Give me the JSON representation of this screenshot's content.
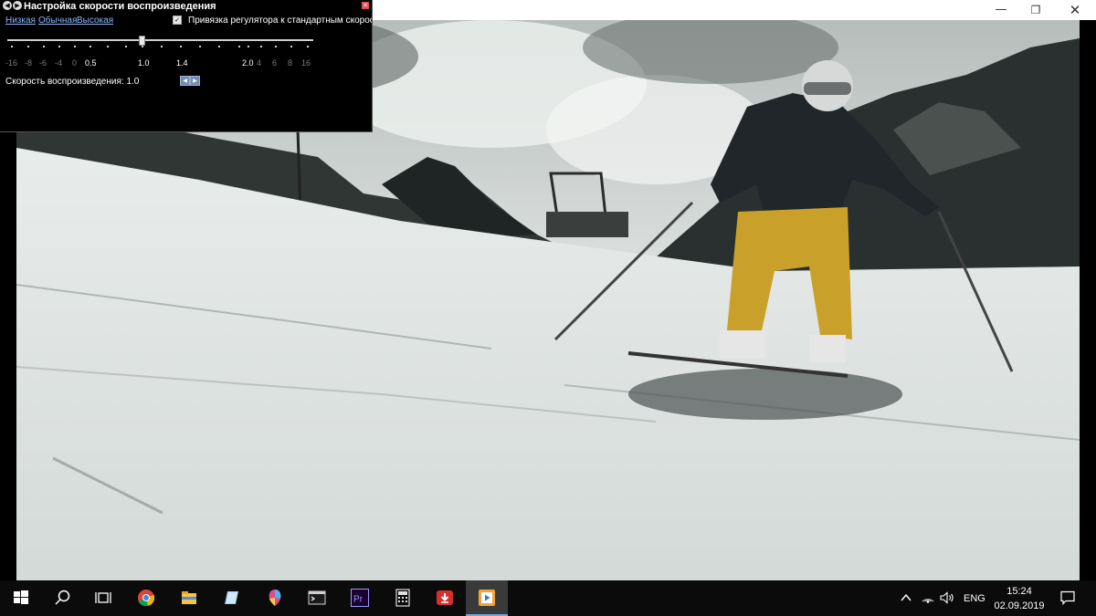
{
  "window": {
    "minimize_icon": "minimize-icon",
    "maximize_icon": "restore-icon",
    "close_icon": "close-icon"
  },
  "speed_dialog": {
    "title": "Настройка скорости воспроизведения",
    "presets": {
      "low": "Низкая",
      "normal": "Обычная",
      "high": "Высокая"
    },
    "bind_checkbox": {
      "checked": true,
      "label": "Привязка регулятора к стандартным скоростям"
    },
    "slider": {
      "value": 1.0
    },
    "scale_labels": [
      "-16",
      "-8",
      "-6",
      "-4",
      "0",
      "0.5",
      "1.0",
      "1.4",
      "2.0",
      "4",
      "6",
      "8",
      "16"
    ],
    "speed_label": "Скорость воспроизведения: 1.0"
  },
  "taskbar": {
    "items": [
      {
        "icon": "windows-start-icon"
      },
      {
        "icon": "search-icon"
      },
      {
        "icon": "task-view-icon"
      },
      {
        "icon": "chrome-icon"
      },
      {
        "icon": "file-explorer-icon"
      },
      {
        "icon": "notepad-icon"
      },
      {
        "icon": "paint-3d-icon"
      },
      {
        "icon": "terminal-icon"
      },
      {
        "icon": "premiere-icon",
        "text": "Pr"
      },
      {
        "icon": "calculator-icon"
      },
      {
        "icon": "downloader-icon"
      },
      {
        "icon": "media-player-icon",
        "active": true
      }
    ],
    "tray": {
      "language": "ENG",
      "time": "15:24",
      "date": "02.09.2019"
    }
  },
  "colors": {
    "accent": "#6ea6e0",
    "link": "#8ab4f8",
    "premiere": "#9999ff",
    "chrome_red": "#db4437",
    "chrome_green": "#0f9d58",
    "chrome_yellow": "#f4b400",
    "chrome_blue": "#4285f4",
    "downloader": "#d32f2f",
    "player_orange": "#f0a23c"
  }
}
